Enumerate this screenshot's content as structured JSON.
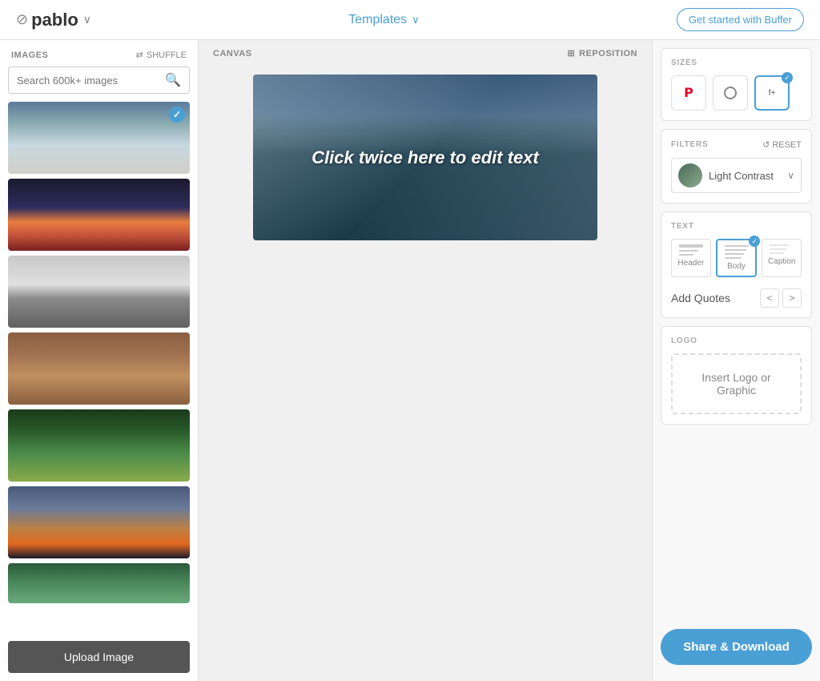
{
  "header": {
    "logo_text": "pablo",
    "logo_chevron": "∨",
    "templates_label": "Templates",
    "templates_chevron": "∨",
    "buffer_btn": "Get started with Buffer"
  },
  "sidebar": {
    "images_label": "IMAGES",
    "shuffle_label": "SHUFFLE",
    "search_placeholder": "Search 600k+ images",
    "upload_btn": "Upload Image"
  },
  "canvas": {
    "toolbar_label": "CANVAS",
    "reposition_label": "REPOSITION",
    "edit_text": "Click twice here to edit text"
  },
  "right_panel": {
    "sizes_label": "SIZES",
    "filters_label": "FILTERS",
    "reset_label": "RESET",
    "filter_name": "Light Contrast",
    "text_label": "TEXT",
    "text_header_label": "Header",
    "text_body_label": "Body",
    "text_caption_label": "Caption",
    "add_quotes_label": "Add Quotes",
    "logo_label": "LOGO",
    "insert_logo_label": "Insert Logo or Graphic",
    "share_btn": "Share & Download"
  }
}
